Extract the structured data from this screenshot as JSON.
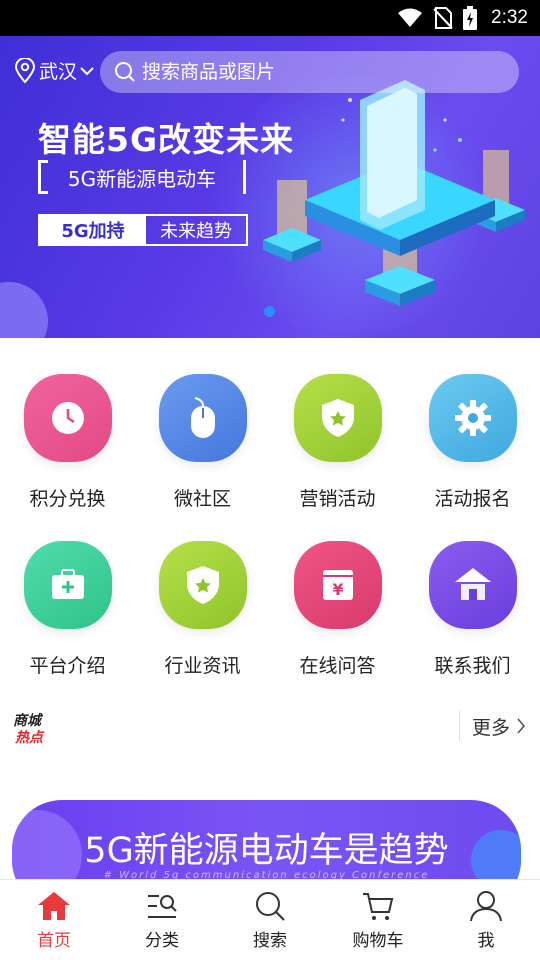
{
  "status_bar": {
    "time": "2:32"
  },
  "header": {
    "location": "武汉",
    "search_placeholder": "搜索商品或图片"
  },
  "banner": {
    "headline": "智能5G改变未来",
    "subtitle": "5G新能源电动车",
    "tag_left": "5G加持",
    "tag_right": "未来趋势",
    "accent_color": "#2d8cff"
  },
  "menu": [
    {
      "label": "积分兑换",
      "icon": "clock-icon",
      "color": "#ee5a96"
    },
    {
      "label": "微社区",
      "icon": "mouse-icon",
      "color": "#5a8ee8"
    },
    {
      "label": "营销活动",
      "icon": "shield-star-icon",
      "color": "#a5d63a"
    },
    {
      "label": "活动报名",
      "icon": "gear-icon",
      "color": "#56b9e8"
    },
    {
      "label": "平台介绍",
      "icon": "medkit-icon",
      "color": "#3fd19a"
    },
    {
      "label": "行业资讯",
      "icon": "shield-star-icon",
      "color": "#a5d63a"
    },
    {
      "label": "在线问答",
      "icon": "yen-box-icon",
      "color": "#e8467a"
    },
    {
      "label": "联系我们",
      "icon": "house-icon",
      "color": "#7a4fe6"
    }
  ],
  "hot": {
    "logo_line1": "商城",
    "logo_line2": "热点",
    "more_label": "更多"
  },
  "promo": {
    "title": "5G新能源电动车是趋势",
    "subtitle": "# World 5g communication ecology Conference"
  },
  "bottom_nav": [
    {
      "label": "首页",
      "icon": "home-icon",
      "active": true
    },
    {
      "label": "分类",
      "icon": "category-icon",
      "active": false
    },
    {
      "label": "搜索",
      "icon": "search-icon",
      "active": false
    },
    {
      "label": "购物车",
      "icon": "cart-icon",
      "active": false
    },
    {
      "label": "我",
      "icon": "user-icon",
      "active": false
    }
  ],
  "colors": {
    "active_tab": "#e8393c",
    "hot_logo": "#e52828"
  }
}
